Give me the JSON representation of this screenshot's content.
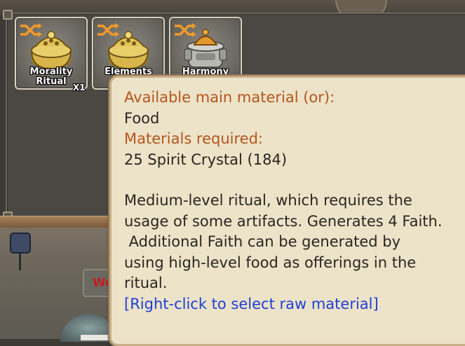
{
  "slots": [
    {
      "label_lines": [
        "Morality",
        "Ritual"
      ],
      "count": "X1",
      "icon": "golden-incense-burner"
    },
    {
      "label_lines": [
        "Elements",
        ""
      ],
      "count": "",
      "icon": "golden-incense-burner"
    },
    {
      "label_lines": [
        "Harmony",
        ""
      ],
      "count": "",
      "icon": "silver-censer"
    }
  ],
  "background": {
    "sign_text": "Wo"
  },
  "tooltip": {
    "main_material_header": "Available main material (or):",
    "main_material_value": "Food",
    "required_header": "Materials required:",
    "required_value": "25 Spirit Crystal (184)",
    "description_lines": [
      "Medium-level ritual, which requires the",
      "usage of some artifacts. Generates 4 Faith.",
      " Additional Faith can be generated by",
      "using high-level food as offerings in the",
      "ritual."
    ],
    "hint": "[Right-click to select raw material]"
  },
  "colors": {
    "tooltip_bg": "#ece3c8",
    "header_orange": "#b5561e",
    "hint_blue": "#1f3fd6"
  }
}
